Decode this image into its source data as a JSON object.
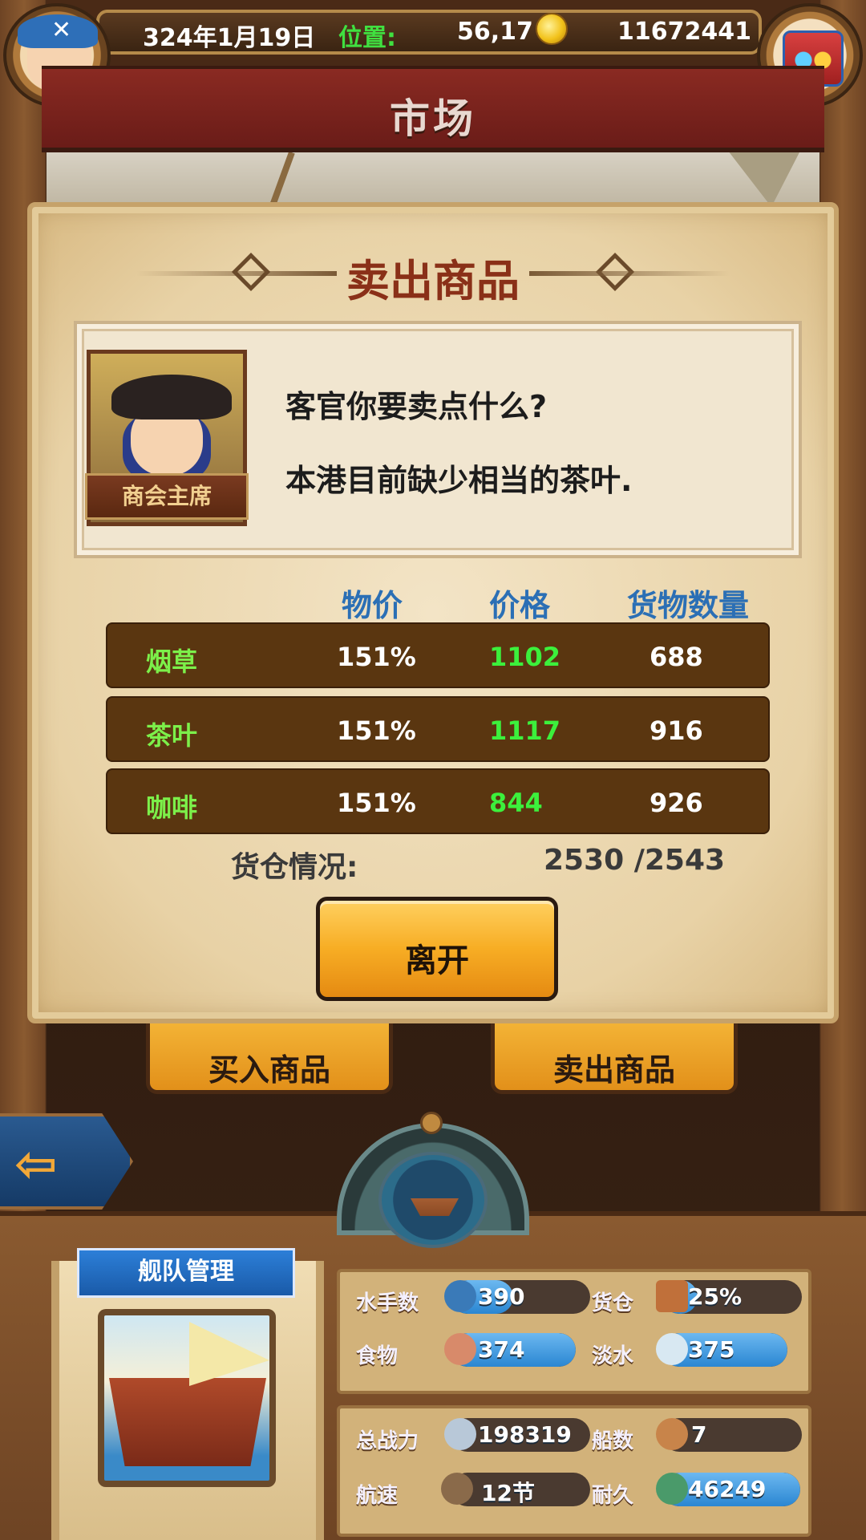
{
  "hud": {
    "date": "324年1月19日",
    "location_label": "位置:",
    "location_value": "56,17",
    "money": "11672441"
  },
  "screen_title": "市场",
  "dialog": {
    "title": "卖出商品",
    "npc_role": "商会主席",
    "npc_line1": "客官你要卖点什么?",
    "npc_line2": "本港目前缺少相当的茶叶.",
    "columns": [
      "物价",
      "价格",
      "货物数量"
    ],
    "goods": [
      {
        "name": "烟草",
        "price_index": "151%",
        "price": "1102",
        "quantity": "688"
      },
      {
        "name": "茶叶",
        "price_index": "151%",
        "price": "1117",
        "quantity": "916"
      },
      {
        "name": "咖啡",
        "price_index": "151%",
        "price": "844",
        "quantity": "926"
      }
    ],
    "cargo_label": "货仓情况:",
    "cargo_value": "2530 /2543",
    "leave_button": "离开"
  },
  "market_buttons": {
    "buy": "买入商品",
    "sell": "卖出商品"
  },
  "fleet": {
    "title": "舰队管理",
    "stats": [
      {
        "label": "水手数",
        "value": "390",
        "icon": "sailor-icon",
        "fill": 0.45
      },
      {
        "label": "货仓",
        "value": "25%",
        "icon": "crate-icon",
        "fill": 0.25
      },
      {
        "label": "食物",
        "value": "374",
        "icon": "meat-icon",
        "fill": 1.0
      },
      {
        "label": "淡水",
        "value": "375",
        "icon": "water-jug-icon",
        "fill": 1.0
      },
      {
        "label": "总战力",
        "value": "198319",
        "icon": "crossed-swords-skull-icon",
        "fill": 0.0
      },
      {
        "label": "船数",
        "value": "7",
        "icon": "ship-count-icon",
        "fill": 0.0
      },
      {
        "label": "航速",
        "value": "12节",
        "icon": "sail-ship-icon",
        "fill": 0.0
      },
      {
        "label": "耐久",
        "value": "46249",
        "icon": "durability-ship-icon",
        "fill": 1.0
      }
    ]
  },
  "colors": {
    "accent_green": "#3cf03c",
    "column_blue": "#2b6fb5",
    "title_red": "#8a3018",
    "button_gold": "#f7ad24"
  }
}
